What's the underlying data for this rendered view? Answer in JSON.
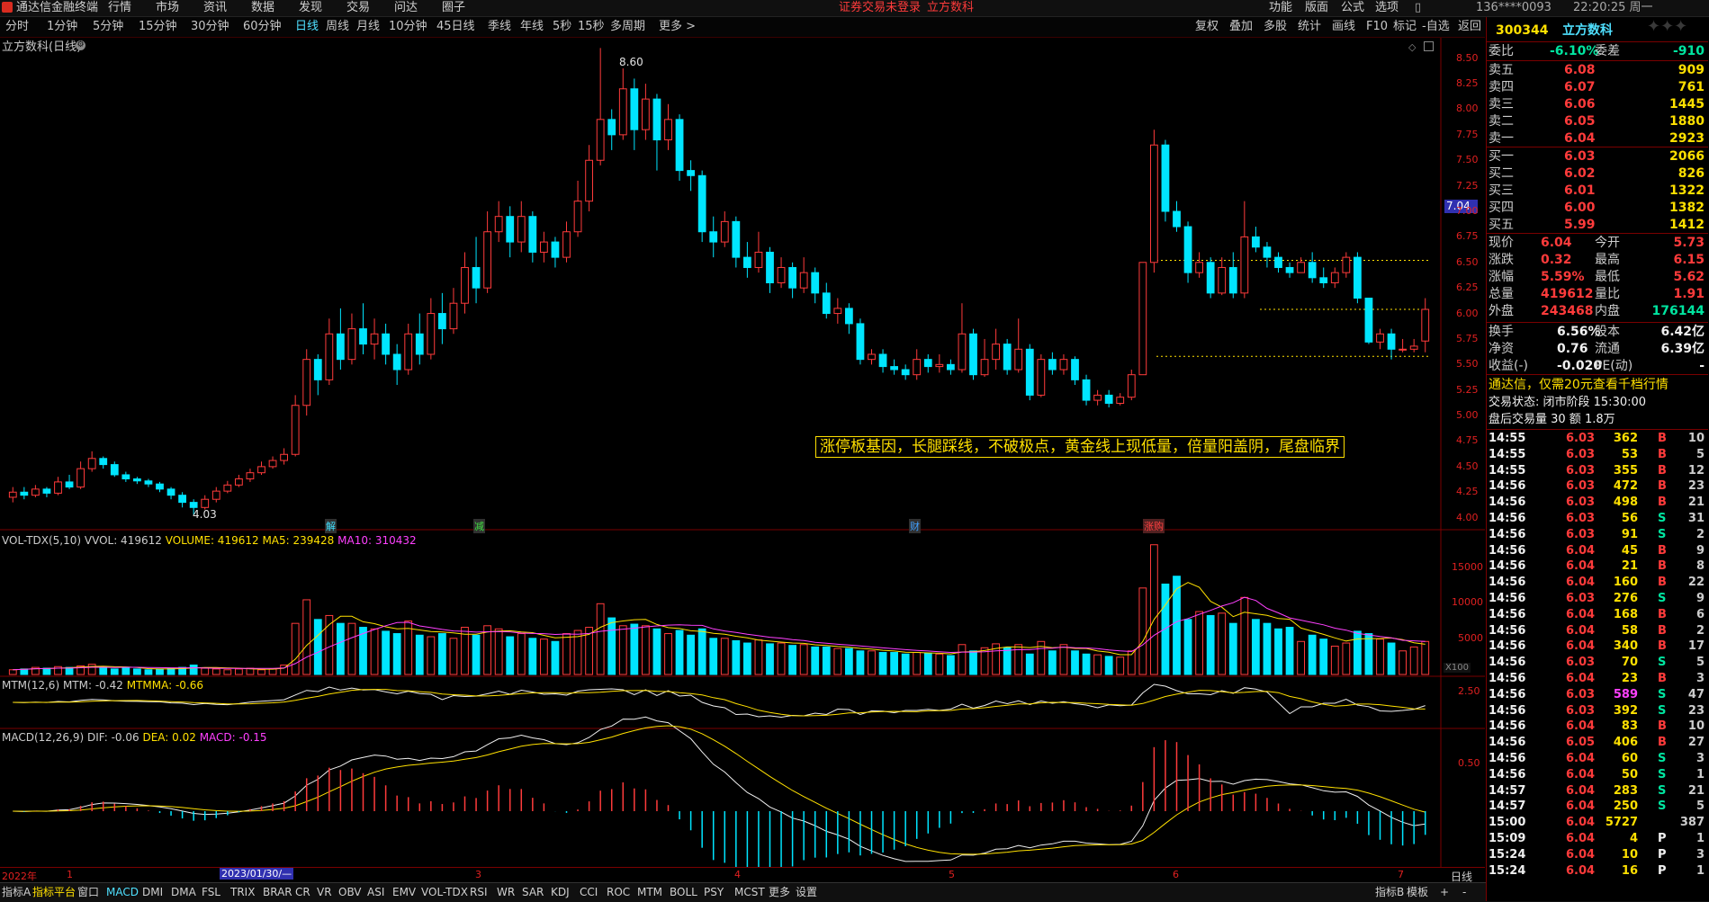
{
  "menubar": {
    "app_title": "通达信金融终端",
    "menus": [
      "行情",
      "市场",
      "资讯",
      "数据",
      "发现",
      "交易",
      "问达",
      "圈子"
    ],
    "warning": "证券交易未登录",
    "stock_name": "立方数科",
    "right_items": [
      "功能",
      "版面",
      "公式",
      "选项"
    ],
    "account": "136****0093",
    "time": "22:20:25 周一"
  },
  "periods": [
    "分时",
    "1分钟",
    "5分钟",
    "15分钟",
    "30分钟",
    "60分钟",
    "日线",
    "周线",
    "月线",
    "10分钟",
    "45日线",
    "季线",
    "年线",
    "5秒",
    "15秒",
    "多周期",
    "更多 >"
  ],
  "active_period": "日线",
  "tools": [
    "复权",
    "叠加",
    "多股",
    "统计",
    "画线",
    "F10",
    "标记",
    "-自选",
    "返回"
  ],
  "chart_title": "立方数科(日线)",
  "price_axis": [
    "8.50",
    "8.25",
    "8.00",
    "7.75",
    "7.50",
    "7.25",
    "7.00",
    "6.75",
    "6.50",
    "6.25",
    "6.00",
    "5.75",
    "5.50",
    "5.25",
    "5.00",
    "4.75",
    "4.50",
    "4.25",
    "4.00"
  ],
  "current_price_marker": "7.04",
  "high_label": "8.60",
  "low_label": "4.03",
  "event_tags": [
    "解",
    "减",
    "财",
    "涨购"
  ],
  "annotation": "涨停板基因，长腿踩线，不破极点，黄金线上现低量，倍量阳盖阴，尾盘临界",
  "vol_panel": {
    "name": "VOL-TDX(5,10)",
    "vvol": "VVOL: 419612",
    "volume": "VOLUME: 419612",
    "ma5": "MA5: 239428",
    "ma10": "MA10: 310432",
    "axis": [
      "15000",
      "10000",
      "5000"
    ],
    "unit": "X100"
  },
  "mtm_panel": {
    "name": "MTM(12,6)",
    "mtm": "MTM: -0.42",
    "mtmma": "MTMMA: -0.66",
    "axis": [
      "2.50"
    ]
  },
  "macd_panel": {
    "name": "MACD(12,26,9)",
    "dif": "DIF: -0.06",
    "dea": "DEA: 0.02",
    "macd": "MACD: -0.15",
    "axis": [
      "0.50"
    ]
  },
  "date_axis": {
    "labels": [
      "2022年",
      "1",
      "2023/01/30/—",
      "3",
      "4",
      "5",
      "6",
      "7"
    ],
    "right": "日线"
  },
  "indicator_tabs": [
    "指标A",
    "指标平台",
    "窗口",
    "MACD",
    "DMI",
    "DMA",
    "FSL",
    "TRIX",
    "BRAR",
    "CR",
    "VR",
    "OBV",
    "ASI",
    "EMV",
    "VOL-TDX",
    "RSI",
    "WR",
    "SAR",
    "KDJ",
    "CCI",
    "ROC",
    "MTM",
    "BOLL",
    "PSY",
    "MCST",
    "更多",
    "设置"
  ],
  "indicator_right": [
    "指标B",
    "模板",
    "+",
    "-"
  ],
  "quote": {
    "code": "300344",
    "name": "立方数科",
    "weibi_label": "委比",
    "weibi": "-6.10%",
    "weicha_label": "委差",
    "weicha": "-910",
    "asks": [
      {
        "label": "卖五",
        "price": "6.08",
        "vol": "909"
      },
      {
        "label": "卖四",
        "price": "6.07",
        "vol": "761"
      },
      {
        "label": "卖三",
        "price": "6.06",
        "vol": "1445"
      },
      {
        "label": "卖二",
        "price": "6.05",
        "vol": "1880"
      },
      {
        "label": "卖一",
        "price": "6.04",
        "vol": "2923"
      }
    ],
    "bids": [
      {
        "label": "买一",
        "price": "6.03",
        "vol": "2066"
      },
      {
        "label": "买二",
        "price": "6.02",
        "vol": "826"
      },
      {
        "label": "买三",
        "price": "6.01",
        "vol": "1322"
      },
      {
        "label": "买四",
        "price": "6.00",
        "vol": "1382"
      },
      {
        "label": "买五",
        "price": "5.99",
        "vol": "1412"
      }
    ],
    "stats": [
      {
        "l1": "现价",
        "v1": "6.04",
        "l2": "今开",
        "v2": "5.73"
      },
      {
        "l1": "涨跌",
        "v1": "0.32",
        "l2": "最高",
        "v2": "6.15"
      },
      {
        "l1": "涨幅",
        "v1": "5.59%",
        "l2": "最低",
        "v2": "5.62"
      },
      {
        "l1": "总量",
        "v1": "419612",
        "l2": "量比",
        "v2": "1.91"
      },
      {
        "l1": "外盘",
        "v1": "243468",
        "l2": "内盘",
        "v2": "176144"
      }
    ],
    "stats2": [
      {
        "l1": "换手",
        "v1": "6.56%",
        "l2": "股本",
        "v2": "6.42亿"
      },
      {
        "l1": "净资",
        "v1": "0.76",
        "l2": "流通",
        "v2": "6.39亿"
      },
      {
        "l1": "收益(-)",
        "v1": "-0.020",
        "l2": "PE(动)",
        "v2": "-"
      }
    ],
    "promo": "通达信，仅需20元查看千档行情",
    "trade_status": "交易状态: 闭市阶段 15:30:00",
    "after_hours": "盘后交易量 30 额 1.8万",
    "ticks": [
      {
        "t": "14:55",
        "p": "6.03",
        "v": "362",
        "d": "B",
        "n": "10"
      },
      {
        "t": "14:55",
        "p": "6.03",
        "v": "53",
        "d": "B",
        "n": "5"
      },
      {
        "t": "14:55",
        "p": "6.03",
        "v": "355",
        "d": "B",
        "n": "12"
      },
      {
        "t": "14:56",
        "p": "6.03",
        "v": "472",
        "d": "B",
        "n": "23"
      },
      {
        "t": "14:56",
        "p": "6.03",
        "v": "498",
        "d": "B",
        "n": "21"
      },
      {
        "t": "14:56",
        "p": "6.03",
        "v": "56",
        "d": "S",
        "n": "31"
      },
      {
        "t": "14:56",
        "p": "6.03",
        "v": "91",
        "d": "S",
        "n": "2"
      },
      {
        "t": "14:56",
        "p": "6.04",
        "v": "45",
        "d": "B",
        "n": "9"
      },
      {
        "t": "14:56",
        "p": "6.04",
        "v": "21",
        "d": "B",
        "n": "8"
      },
      {
        "t": "14:56",
        "p": "6.04",
        "v": "160",
        "d": "B",
        "n": "22"
      },
      {
        "t": "14:56",
        "p": "6.03",
        "v": "276",
        "d": "S",
        "n": "9"
      },
      {
        "t": "14:56",
        "p": "6.04",
        "v": "168",
        "d": "B",
        "n": "6"
      },
      {
        "t": "14:56",
        "p": "6.04",
        "v": "58",
        "d": "B",
        "n": "2"
      },
      {
        "t": "14:56",
        "p": "6.04",
        "v": "340",
        "d": "B",
        "n": "17"
      },
      {
        "t": "14:56",
        "p": "6.03",
        "v": "70",
        "d": "S",
        "n": "5"
      },
      {
        "t": "14:56",
        "p": "6.04",
        "v": "23",
        "d": "B",
        "n": "3"
      },
      {
        "t": "14:56",
        "p": "6.03",
        "v": "589",
        "d": "S",
        "n": "47"
      },
      {
        "t": "14:56",
        "p": "6.03",
        "v": "392",
        "d": "S",
        "n": "23"
      },
      {
        "t": "14:56",
        "p": "6.04",
        "v": "83",
        "d": "B",
        "n": "10"
      },
      {
        "t": "14:56",
        "p": "6.05",
        "v": "406",
        "d": "B",
        "n": "27"
      },
      {
        "t": "14:56",
        "p": "6.04",
        "v": "60",
        "d": "S",
        "n": "3"
      },
      {
        "t": "14:56",
        "p": "6.04",
        "v": "50",
        "d": "S",
        "n": "1"
      },
      {
        "t": "14:57",
        "p": "6.04",
        "v": "283",
        "d": "S",
        "n": "21"
      },
      {
        "t": "14:57",
        "p": "6.04",
        "v": "250",
        "d": "S",
        "n": "5"
      },
      {
        "t": "15:00",
        "p": "6.04",
        "v": "5727",
        "d": "",
        "n": "387"
      },
      {
        "t": "15:09",
        "p": "6.04",
        "v": "4",
        "d": "P",
        "n": "1"
      },
      {
        "t": "15:24",
        "p": "6.04",
        "v": "10",
        "d": "P",
        "n": "3"
      },
      {
        "t": "15:24",
        "p": "6.04",
        "v": "16",
        "d": "P",
        "n": "1"
      }
    ]
  },
  "colors": {
    "up": "#ff3b3b",
    "down": "#00e5ff",
    "yellow": "#ffe000",
    "magenta": "#ff40ff",
    "white": "#f0f0f0",
    "panel_border": "#7a0000"
  },
  "chart_data": {
    "type": "candlestick",
    "title": "立方数科(日线)",
    "ylim": [
      3.9,
      8.7
    ],
    "high": 8.6,
    "low": 4.03,
    "last_close": 6.04,
    "candles": [
      [
        4.2,
        4.25,
        4.3,
        4.15
      ],
      [
        4.25,
        4.22,
        4.3,
        4.18
      ],
      [
        4.22,
        4.28,
        4.32,
        4.2
      ],
      [
        4.28,
        4.24,
        4.3,
        4.2
      ],
      [
        4.24,
        4.35,
        4.4,
        4.22
      ],
      [
        4.35,
        4.3,
        4.42,
        4.28
      ],
      [
        4.3,
        4.48,
        4.55,
        4.28
      ],
      [
        4.48,
        4.58,
        4.65,
        4.45
      ],
      [
        4.58,
        4.52,
        4.6,
        4.48
      ],
      [
        4.52,
        4.42,
        4.55,
        4.4
      ],
      [
        4.42,
        4.38,
        4.45,
        4.35
      ],
      [
        4.38,
        4.36,
        4.4,
        4.33
      ],
      [
        4.36,
        4.33,
        4.38,
        4.3
      ],
      [
        4.33,
        4.28,
        4.35,
        4.25
      ],
      [
        4.28,
        4.22,
        4.3,
        4.18
      ],
      [
        4.22,
        4.15,
        4.25,
        4.1
      ],
      [
        4.15,
        4.1,
        4.18,
        4.03
      ],
      [
        4.1,
        4.18,
        4.22,
        4.08
      ],
      [
        4.18,
        4.26,
        4.3,
        4.15
      ],
      [
        4.26,
        4.32,
        4.36,
        4.24
      ],
      [
        4.32,
        4.38,
        4.42,
        4.3
      ],
      [
        4.38,
        4.44,
        4.48,
        4.35
      ],
      [
        4.44,
        4.5,
        4.55,
        4.42
      ],
      [
        4.5,
        4.56,
        4.6,
        4.48
      ],
      [
        4.56,
        4.62,
        4.68,
        4.52
      ],
      [
        4.62,
        5.1,
        5.2,
        4.6
      ],
      [
        5.1,
        5.55,
        5.65,
        5.0
      ],
      [
        5.55,
        5.35,
        5.6,
        5.2
      ],
      [
        5.35,
        5.8,
        5.95,
        5.3
      ],
      [
        5.8,
        5.55,
        6.05,
        5.45
      ],
      [
        5.55,
        5.85,
        6.0,
        5.5
      ],
      [
        5.85,
        5.7,
        6.1,
        5.6
      ],
      [
        5.7,
        5.8,
        5.95,
        5.55
      ],
      [
        5.8,
        5.6,
        5.9,
        5.5
      ],
      [
        5.6,
        5.45,
        5.7,
        5.3
      ],
      [
        5.45,
        5.8,
        5.9,
        5.4
      ],
      [
        5.8,
        5.6,
        6.0,
        5.5
      ],
      [
        5.6,
        6.0,
        6.15,
        5.55
      ],
      [
        6.0,
        5.85,
        6.2,
        5.7
      ],
      [
        5.85,
        6.1,
        6.25,
        5.8
      ],
      [
        6.1,
        6.45,
        6.6,
        6.0
      ],
      [
        6.45,
        6.25,
        6.75,
        6.1
      ],
      [
        6.25,
        6.8,
        7.0,
        6.2
      ],
      [
        6.8,
        6.95,
        7.1,
        6.7
      ],
      [
        6.95,
        6.7,
        7.05,
        6.55
      ],
      [
        6.7,
        6.95,
        7.1,
        6.6
      ],
      [
        6.95,
        6.6,
        7.0,
        6.5
      ],
      [
        6.6,
        6.7,
        6.8,
        6.5
      ],
      [
        6.7,
        6.55,
        6.75,
        6.45
      ],
      [
        6.55,
        6.8,
        6.9,
        6.5
      ],
      [
        6.8,
        7.1,
        7.3,
        6.75
      ],
      [
        7.1,
        7.5,
        7.65,
        7.0
      ],
      [
        7.5,
        7.9,
        8.6,
        7.45
      ],
      [
        7.9,
        7.75,
        8.0,
        7.6
      ],
      [
        7.75,
        8.2,
        8.4,
        7.7
      ],
      [
        8.2,
        7.8,
        8.3,
        7.6
      ],
      [
        7.8,
        8.1,
        8.25,
        7.7
      ],
      [
        8.1,
        7.7,
        8.15,
        7.4
      ],
      [
        7.7,
        7.9,
        8.05,
        7.6
      ],
      [
        7.9,
        7.4,
        7.95,
        7.3
      ],
      [
        7.4,
        7.35,
        7.5,
        7.2
      ],
      [
        7.35,
        6.8,
        7.4,
        6.7
      ],
      [
        6.8,
        6.7,
        6.95,
        6.55
      ],
      [
        6.7,
        6.9,
        7.0,
        6.65
      ],
      [
        6.9,
        6.55,
        6.95,
        6.45
      ],
      [
        6.55,
        6.45,
        6.7,
        6.35
      ],
      [
        6.45,
        6.6,
        6.8,
        6.4
      ],
      [
        6.6,
        6.3,
        6.65,
        6.2
      ],
      [
        6.3,
        6.45,
        6.55,
        6.25
      ],
      [
        6.45,
        6.25,
        6.5,
        6.15
      ],
      [
        6.25,
        6.4,
        6.55,
        6.2
      ],
      [
        6.4,
        6.2,
        6.45,
        6.1
      ],
      [
        6.2,
        6.0,
        6.3,
        5.95
      ],
      [
        6.0,
        6.05,
        6.15,
        5.9
      ],
      [
        6.05,
        5.9,
        6.1,
        5.8
      ],
      [
        5.9,
        5.55,
        5.95,
        5.5
      ],
      [
        5.55,
        5.6,
        5.65,
        5.5
      ],
      [
        5.6,
        5.48,
        5.65,
        5.42
      ],
      [
        5.48,
        5.45,
        5.55,
        5.4
      ],
      [
        5.45,
        5.4,
        5.5,
        5.35
      ],
      [
        5.4,
        5.55,
        5.65,
        5.35
      ],
      [
        5.55,
        5.48,
        5.6,
        5.42
      ],
      [
        5.48,
        5.5,
        5.6,
        5.42
      ],
      [
        5.5,
        5.45,
        5.55,
        5.4
      ],
      [
        5.45,
        5.8,
        6.1,
        5.42
      ],
      [
        5.8,
        5.4,
        5.85,
        5.35
      ],
      [
        5.4,
        5.55,
        5.75,
        5.38
      ],
      [
        5.55,
        5.7,
        5.85,
        5.45
      ],
      [
        5.7,
        5.45,
        5.75,
        5.4
      ],
      [
        5.45,
        5.65,
        5.95,
        5.42
      ],
      [
        5.65,
        5.2,
        5.7,
        5.15
      ],
      [
        5.2,
        5.55,
        5.6,
        5.18
      ],
      [
        5.55,
        5.45,
        5.62,
        5.4
      ],
      [
        5.45,
        5.55,
        5.6,
        5.4
      ],
      [
        5.55,
        5.35,
        5.58,
        5.3
      ],
      [
        5.35,
        5.15,
        5.4,
        5.1
      ],
      [
        5.15,
        5.2,
        5.25,
        5.1
      ],
      [
        5.2,
        5.12,
        5.25,
        5.08
      ],
      [
        5.12,
        5.18,
        5.22,
        5.1
      ],
      [
        5.18,
        5.4,
        5.45,
        5.15
      ],
      [
        5.4,
        6.5,
        6.5,
        5.6
      ],
      [
        6.5,
        7.65,
        7.8,
        6.4
      ],
      [
        7.65,
        7.0,
        7.7,
        6.9
      ],
      [
        7.0,
        6.85,
        7.1,
        6.8
      ],
      [
        6.85,
        6.4,
        6.9,
        6.3
      ],
      [
        6.4,
        6.5,
        6.6,
        6.35
      ],
      [
        6.5,
        6.2,
        6.55,
        6.15
      ],
      [
        6.2,
        6.45,
        6.55,
        6.18
      ],
      [
        6.45,
        6.2,
        6.6,
        6.15
      ],
      [
        6.2,
        6.75,
        7.1,
        6.15
      ],
      [
        6.75,
        6.65,
        6.85,
        6.6
      ],
      [
        6.65,
        6.55,
        6.7,
        6.45
      ],
      [
        6.55,
        6.45,
        6.6,
        6.4
      ],
      [
        6.45,
        6.4,
        6.5,
        6.35
      ],
      [
        6.4,
        6.5,
        6.55,
        6.4
      ],
      [
        6.5,
        6.35,
        6.6,
        6.3
      ],
      [
        6.35,
        6.3,
        6.45,
        6.25
      ],
      [
        6.3,
        6.4,
        6.45,
        6.25
      ],
      [
        6.4,
        6.55,
        6.6,
        6.35
      ],
      [
        6.55,
        6.15,
        6.6,
        6.1
      ],
      [
        6.15,
        5.72,
        6.1,
        5.7
      ],
      [
        5.72,
        5.8,
        5.85,
        5.65
      ],
      [
        5.8,
        5.65,
        5.85,
        5.55
      ],
      [
        5.65,
        5.65,
        5.75,
        5.62
      ],
      [
        5.65,
        5.68,
        5.75,
        5.62
      ],
      [
        5.73,
        6.04,
        6.15,
        5.62
      ]
    ],
    "volume": [
      600,
      700,
      900,
      800,
      1000,
      900,
      1100,
      1300,
      900,
      700,
      800,
      700,
      600,
      700,
      800,
      900,
      1200,
      800,
      700,
      600,
      700,
      800,
      600,
      700,
      1200,
      6500,
      9500,
      7000,
      7500,
      6500,
      6500,
      6000,
      5800,
      5500,
      5200,
      6800,
      5000,
      4800,
      5200,
      4600,
      6000,
      5000,
      6200,
      5800,
      4800,
      5200,
      4600,
      4500,
      4200,
      5200,
      5600,
      6000,
      9000,
      7200,
      6200,
      6400,
      6200,
      5800,
      5200,
      5600,
      5000,
      5800,
      4600,
      4600,
      4300,
      4000,
      4400,
      3900,
      4000,
      3700,
      3800,
      3500,
      3500,
      3300,
      3300,
      3000,
      3000,
      2800,
      2800,
      2600,
      2800,
      2700,
      2600,
      2400,
      3800,
      3000,
      3400,
      3900,
      3400,
      3800,
      2600,
      4200,
      3000,
      3800,
      3000,
      2600,
      2500,
      2300,
      2200,
      3000,
      11000,
      16500,
      11500,
      12500,
      7000,
      8000,
      7500,
      7800,
      6500,
      9800,
      7000,
      6500,
      5800,
      6000,
      4200,
      5000,
      4500,
      3600,
      4000,
      5500,
      5200,
      4500,
      4000,
      3000,
      3500,
      4200
    ],
    "series": [
      {
        "name": "MA5"
      },
      {
        "name": "MA10"
      }
    ]
  }
}
